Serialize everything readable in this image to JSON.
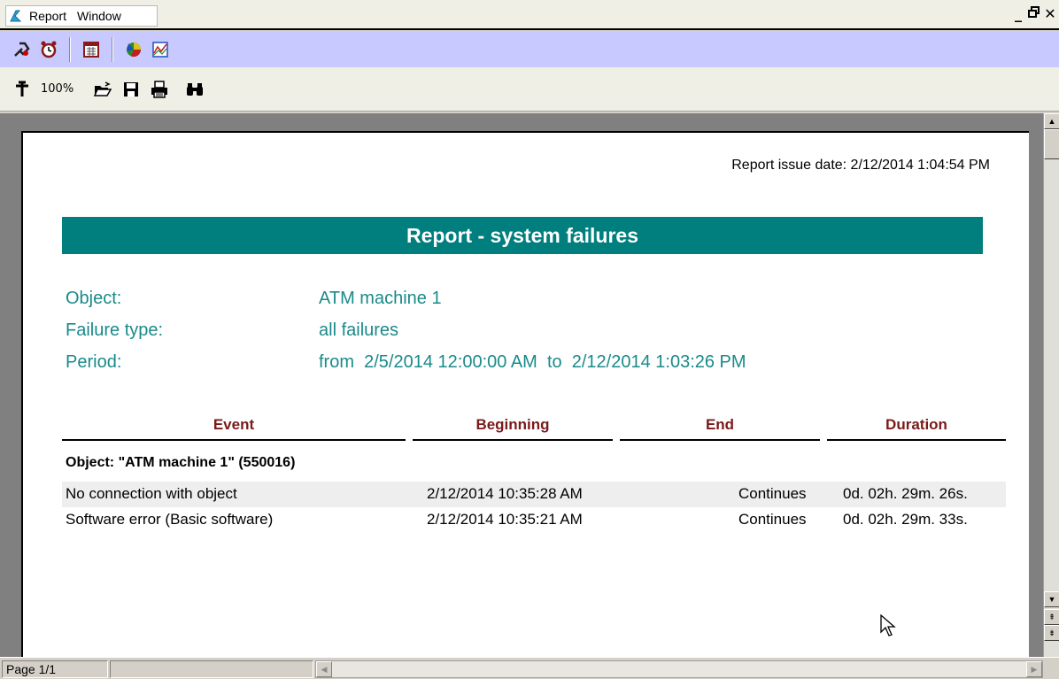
{
  "menubar": {
    "items": [
      "Report",
      "Window"
    ],
    "window_controls": [
      "_",
      "🗗",
      "✕"
    ]
  },
  "toolbar1": {
    "icons": [
      "tools-icon",
      "alarm-clock-icon",
      "calendar-icon",
      "pie-chart-icon",
      "line-chart-icon"
    ]
  },
  "toolbar2": {
    "zoom": "100%",
    "icons": [
      "zoom-pin-icon",
      "open-folder-icon",
      "save-icon",
      "print-icon",
      "find-icon"
    ]
  },
  "report": {
    "issue_date": "Report issue date: 2/12/2014 1:04:54 PM",
    "title": "Report - system failures",
    "object_label": "Object:",
    "object_value": "ATM machine 1",
    "failure_type_label": "Failure type:",
    "failure_type_value": "all failures",
    "period_label": "Period:",
    "period_value": "from  2/5/2014 12:00:00 AM  to  2/12/2014 1:03:26 PM",
    "columns": {
      "event": "Event",
      "beginning": "Beginning",
      "end": "End",
      "duration": "Duration"
    },
    "object_heading": "Object: \"ATM machine 1\" (550016)",
    "rows": [
      {
        "event": "No connection with object",
        "beginning": "2/12/2014 10:35:28 AM",
        "end": "Continues",
        "duration": "0d. 02h. 29m. 26s."
      },
      {
        "event": "Software error (Basic software)",
        "beginning": "2/12/2014 10:35:21 AM",
        "end": "Continues",
        "duration": "0d. 02h. 29m. 33s."
      }
    ]
  },
  "statusbar": {
    "page": "Page 1/1"
  },
  "colors": {
    "title_bar": "#007f7e",
    "info_text": "#1a8a8a",
    "column_header": "#7a1a1a",
    "toolbar_lavender": "#c8c9ff"
  }
}
